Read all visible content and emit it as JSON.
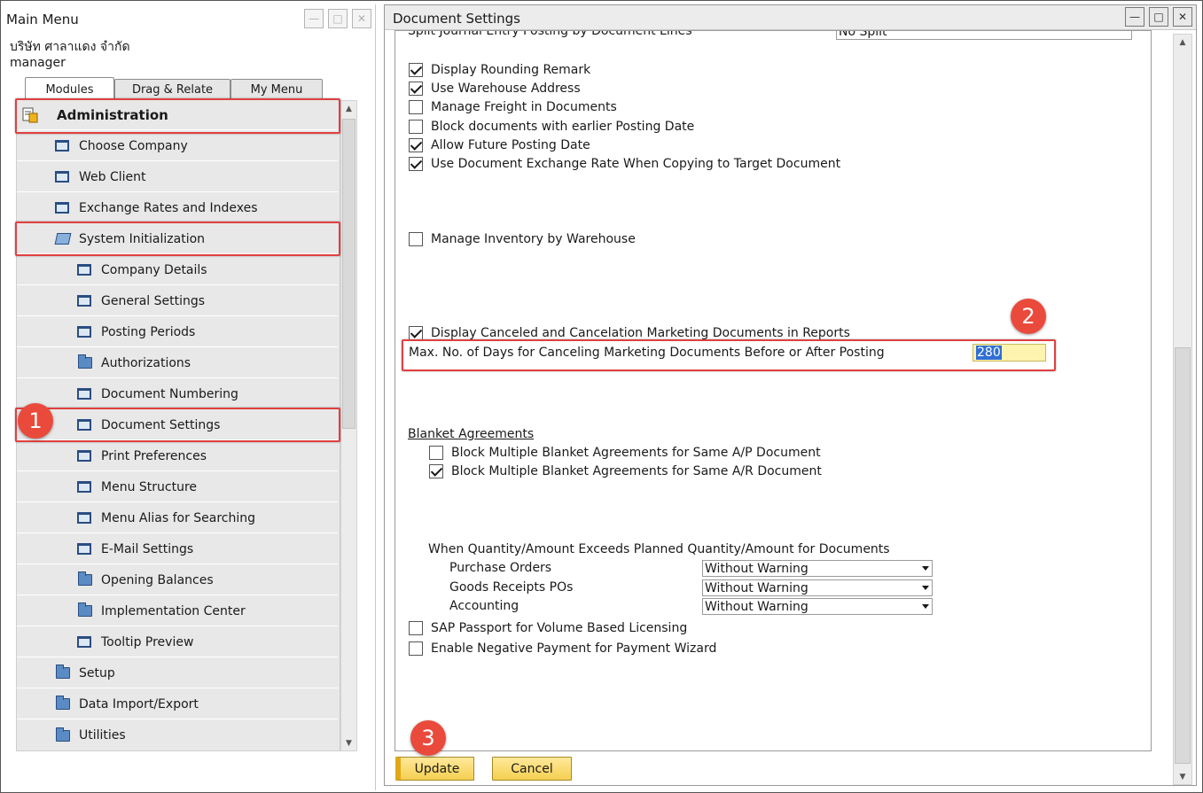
{
  "main_menu": {
    "title": "Main Menu",
    "company_name": "บริษัท ศาลาแดง จำกัด",
    "user_name": "manager",
    "tabs": [
      "Modules",
      "Drag & Relate",
      "My Menu"
    ],
    "tree": {
      "administration": "Administration",
      "choose_company": "Choose Company",
      "web_client": "Web Client",
      "exchange_rates": "Exchange Rates and Indexes",
      "system_initialization": "System Initialization",
      "company_details": "Company Details",
      "general_settings": "General Settings",
      "posting_periods": "Posting Periods",
      "authorizations": "Authorizations",
      "document_numbering": "Document Numbering",
      "document_settings": "Document Settings",
      "print_preferences": "Print Preferences",
      "menu_structure": "Menu Structure",
      "menu_alias": "Menu Alias for Searching",
      "email_settings": "E-Mail Settings",
      "opening_balances": "Opening Balances",
      "implementation_center": "Implementation Center",
      "tooltip_preview": "Tooltip Preview",
      "setup": "Setup",
      "data_import_export": "Data Import/Export",
      "utilities": "Utilities"
    }
  },
  "document_settings": {
    "title": "Document Settings",
    "split_journal_label": "Split Journal Entry Posting by Document Lines",
    "split_journal_value": "No Split",
    "checkboxes": {
      "display_rounding_remark": {
        "label": "Display Rounding Remark",
        "checked": true
      },
      "use_warehouse_address": {
        "label": "Use Warehouse Address",
        "checked": true
      },
      "manage_freight": {
        "label": "Manage Freight in Documents",
        "checked": false
      },
      "block_earlier_posting": {
        "label": "Block documents with earlier Posting Date",
        "checked": false
      },
      "allow_future_posting": {
        "label": "Allow Future Posting Date",
        "checked": true
      },
      "use_doc_exchange_rate": {
        "label": "Use Document Exchange Rate When Copying to Target Document",
        "checked": true
      },
      "manage_inventory_by_wh": {
        "label": "Manage Inventory by Warehouse",
        "checked": false
      },
      "display_canceled_docs": {
        "label": "Display Canceled and Cancelation Marketing Documents in Reports",
        "checked": true
      },
      "block_blanket_ap": {
        "label": "Block Multiple Blanket Agreements for Same A/P Document",
        "checked": false
      },
      "block_blanket_ar": {
        "label": "Block Multiple Blanket Agreements for Same A/R Document",
        "checked": true
      },
      "sap_passport": {
        "label": "SAP Passport for Volume Based Licensing",
        "checked": false
      },
      "negative_payment": {
        "label": "Enable Negative Payment for Payment Wizard",
        "checked": false
      }
    },
    "max_days_label": "Max. No. of Days for Canceling Marketing Documents Before or After Posting",
    "max_days_value": "280",
    "blanket_agreements_heading": "Blanket Agreements",
    "exceeds_heading": "When Quantity/Amount Exceeds Planned Quantity/Amount for Documents",
    "exceeds_rows": [
      {
        "label": "Purchase Orders",
        "value": "Without Warning"
      },
      {
        "label": "Goods Receipts POs",
        "value": "Without Warning"
      },
      {
        "label": "Accounting",
        "value": "Without Warning"
      }
    ],
    "buttons": {
      "update": "Update",
      "cancel": "Cancel"
    }
  },
  "annotations": {
    "step1": "1",
    "step2": "2",
    "step3": "3"
  },
  "colors": {
    "highlight_red": "#e04040",
    "badge_red": "#ea4a3c",
    "sap_button_yellow": "#f5cf50",
    "tree_blue": "#2a4d82"
  }
}
